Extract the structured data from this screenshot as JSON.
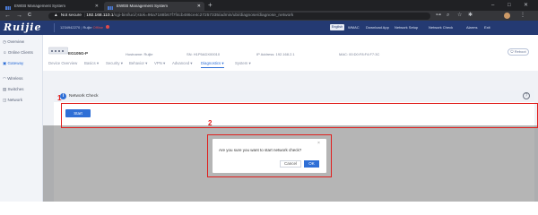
{
  "browser": {
    "tabs": [
      {
        "title": "EWEB Management System"
      },
      {
        "title": "EWEB Management System"
      }
    ],
    "new_tab": "+",
    "window_controls": {
      "minimize": "–",
      "maximize": "□",
      "close": "✕"
    },
    "nav": {
      "back": "←",
      "forward": "→",
      "reload": "C"
    },
    "security": "Not secure",
    "url_host": "192.168.110.1",
    "url_path": "/cgi-bin/luci/;stok=96a7188b67f7f4cb486ce4c27257335/admin/ubi/diagnose/diagnose_network"
  },
  "app": {
    "logo": "Ruijie",
    "device_serial": "1234942270",
    "device_link": "Ruijie",
    "device_status": "Offline",
    "language": "English",
    "header_links": [
      "WMAC",
      "Download App",
      "Network Setup",
      "Network Check",
      "Alarms",
      "Exit"
    ]
  },
  "sidebar": {
    "items": [
      {
        "label": "Overview",
        "active": false
      },
      {
        "label": "Online Clients",
        "active": false
      },
      {
        "label": "Gateway",
        "active": true
      },
      {
        "label": "Wireless",
        "active": false
      },
      {
        "label": "Switches",
        "active": false
      },
      {
        "label": "Network",
        "active": false
      }
    ]
  },
  "device_info": {
    "model": "EG105G-P",
    "hostname_label": "Hostname: Ruijie",
    "sn_label": "SN: H1P5ADX00010",
    "ip_label": "IP Address: 192.168.2.1",
    "mac_label": "MAC: 00:D0:F8:F4:F7:3C",
    "reboot": "Reboot"
  },
  "nav_tabs": [
    {
      "label": "Device Overview",
      "active": false
    },
    {
      "label": "Basics ▾",
      "active": false
    },
    {
      "label": "Security ▾",
      "active": false
    },
    {
      "label": "Behavior ▾",
      "active": false
    },
    {
      "label": "VPN ▾",
      "active": false
    },
    {
      "label": "Advanced ▾",
      "active": false
    },
    {
      "label": "Diagnostics ▾",
      "active": true
    },
    {
      "label": "System ▾",
      "active": false
    }
  ],
  "panel": {
    "title": "Network Check",
    "start_label": "Start",
    "help_glyph": "?"
  },
  "dialog": {
    "message": "Are you sure you want to start network check?",
    "cancel_label": "Cancel",
    "ok_label": "OK",
    "close_glyph": "×"
  },
  "annotations": [
    "1",
    "2"
  ],
  "colors": {
    "header": "#243a72",
    "accent": "#2f6fd6",
    "annotation": "#e0201e",
    "offline": "#e04a4a"
  }
}
